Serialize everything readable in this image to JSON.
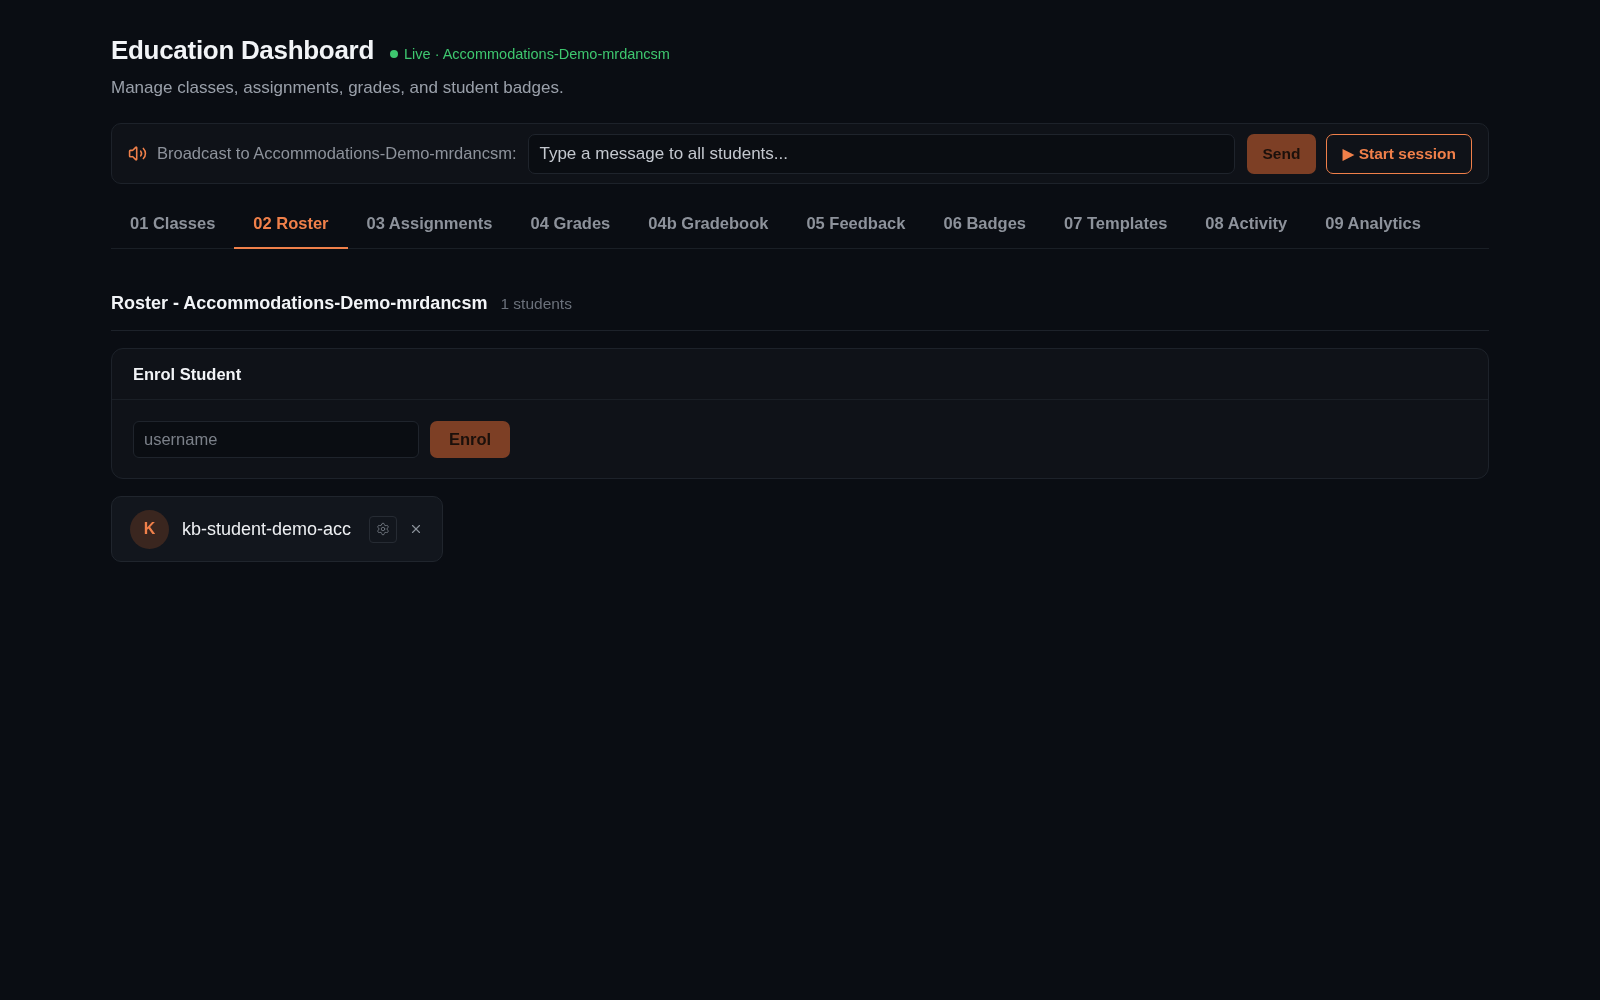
{
  "header": {
    "title": "Education Dashboard",
    "status": {
      "live": true,
      "text": "Live · Accommodations-Demo-mrdancsm"
    },
    "subtitle": "Manage classes, assignments, grades, and student badges."
  },
  "broadcast": {
    "label": "Broadcast to Accommodations-Demo-mrdancsm:",
    "placeholder": "Type a message to all students...",
    "send_button": "Send",
    "session_button": "▶ Start session"
  },
  "tabs": [
    {
      "label": "01 Classes",
      "selected": false
    },
    {
      "label": "02 Roster",
      "selected": true
    },
    {
      "label": "03 Assignments",
      "selected": false
    },
    {
      "label": "04 Grades",
      "selected": false
    },
    {
      "label": "04b Gradebook",
      "selected": false
    },
    {
      "label": "05 Feedback",
      "selected": false
    },
    {
      "label": "06 Badges",
      "selected": false
    },
    {
      "label": "07 Templates",
      "selected": false
    },
    {
      "label": "08 Activity",
      "selected": false
    },
    {
      "label": "09 Analytics",
      "selected": false
    }
  ],
  "roster": {
    "title": "Roster - Accommodations-Demo-mrdancsm",
    "count": "1 students",
    "enrol": {
      "title": "Enrol Student",
      "placeholder": "username",
      "button": "Enrol"
    },
    "students": [
      {
        "initial": "K",
        "name": "kb-student-demo-acc"
      }
    ]
  }
}
